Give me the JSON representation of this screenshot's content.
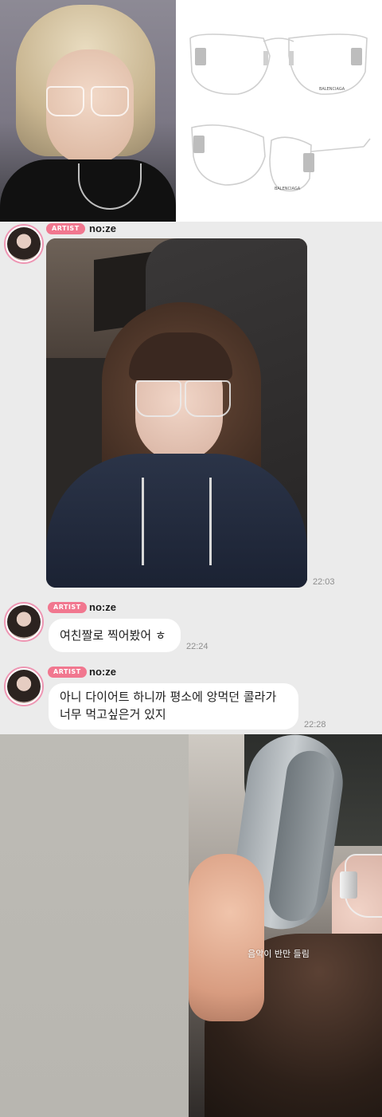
{
  "top_collage": {
    "product_brand_text": "BALENCIAGA"
  },
  "chat": {
    "messages": [
      {
        "badge": "ARTIST",
        "sender": "no:ze",
        "type": "photo",
        "time": "22:03"
      },
      {
        "badge": "ARTIST",
        "sender": "no:ze",
        "type": "text",
        "lines": [
          "여친짤로 찍어봤어 ㅎ"
        ],
        "time": "22:24"
      },
      {
        "badge": "ARTIST",
        "sender": "no:ze",
        "type": "text",
        "lines": [
          "아니 다이어트 하니까 평소에 앙먹던 콜라가",
          "너무 먹고싶은거 있지"
        ],
        "time": "22:28"
      }
    ]
  },
  "bottom_collage": {
    "caption": "음악이 반만 들림"
  },
  "colors": {
    "badge": "#f1778f",
    "avatar_ring": "#ee96b3",
    "chat_bg": "#ebebeb",
    "bubble": "#ffffff"
  }
}
